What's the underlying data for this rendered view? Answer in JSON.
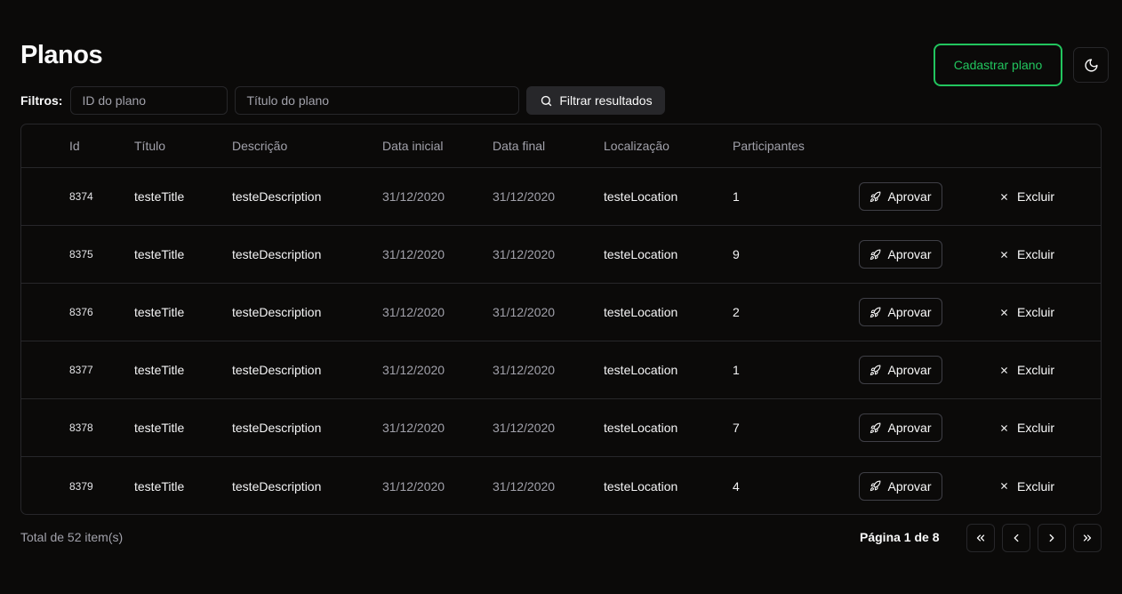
{
  "page_title": "Planos",
  "header": {
    "create_label": "Cadastrar plano",
    "theme_icon": "moon-icon"
  },
  "filters": {
    "label": "Filtros:",
    "id_placeholder": "ID do plano",
    "title_placeholder": "Título do plano",
    "filter_button": "Filtrar resultados",
    "filter_icon": "search-icon"
  },
  "table": {
    "columns": {
      "id": "Id",
      "title": "Título",
      "description": "Descrição",
      "start": "Data inicial",
      "end": "Data final",
      "location": "Localização",
      "participants": "Participantes"
    },
    "rows": [
      {
        "id": "8374",
        "title": "testeTitle",
        "description": "testeDescription",
        "start": "31/12/2020",
        "end": "31/12/2020",
        "location": "testeLocation",
        "participants": "1"
      },
      {
        "id": "8375",
        "title": "testeTitle",
        "description": "testeDescription",
        "start": "31/12/2020",
        "end": "31/12/2020",
        "location": "testeLocation",
        "participants": "9"
      },
      {
        "id": "8376",
        "title": "testeTitle",
        "description": "testeDescription",
        "start": "31/12/2020",
        "end": "31/12/2020",
        "location": "testeLocation",
        "participants": "2"
      },
      {
        "id": "8377",
        "title": "testeTitle",
        "description": "testeDescription",
        "start": "31/12/2020",
        "end": "31/12/2020",
        "location": "testeLocation",
        "participants": "1"
      },
      {
        "id": "8378",
        "title": "testeTitle",
        "description": "testeDescription",
        "start": "31/12/2020",
        "end": "31/12/2020",
        "location": "testeLocation",
        "participants": "7"
      },
      {
        "id": "8379",
        "title": "testeTitle",
        "description": "testeDescription",
        "start": "31/12/2020",
        "end": "31/12/2020",
        "location": "testeLocation",
        "participants": "4"
      }
    ],
    "approve_label": "Aprovar",
    "approve_icon": "rocket-icon",
    "delete_label": "Excluir",
    "delete_icon": "close-icon"
  },
  "footer": {
    "total_text": "Total de 52 item(s)",
    "page_text": "Página 1 de 8",
    "first_icon": "chevrons-left-icon",
    "prev_icon": "chevron-left-icon",
    "next_icon": "chevron-right-icon",
    "last_icon": "chevrons-right-icon"
  },
  "colors": {
    "background": "#0b0a09",
    "accent": "#22c55e",
    "border": "#27272a",
    "muted_text": "#a1a1aa"
  }
}
